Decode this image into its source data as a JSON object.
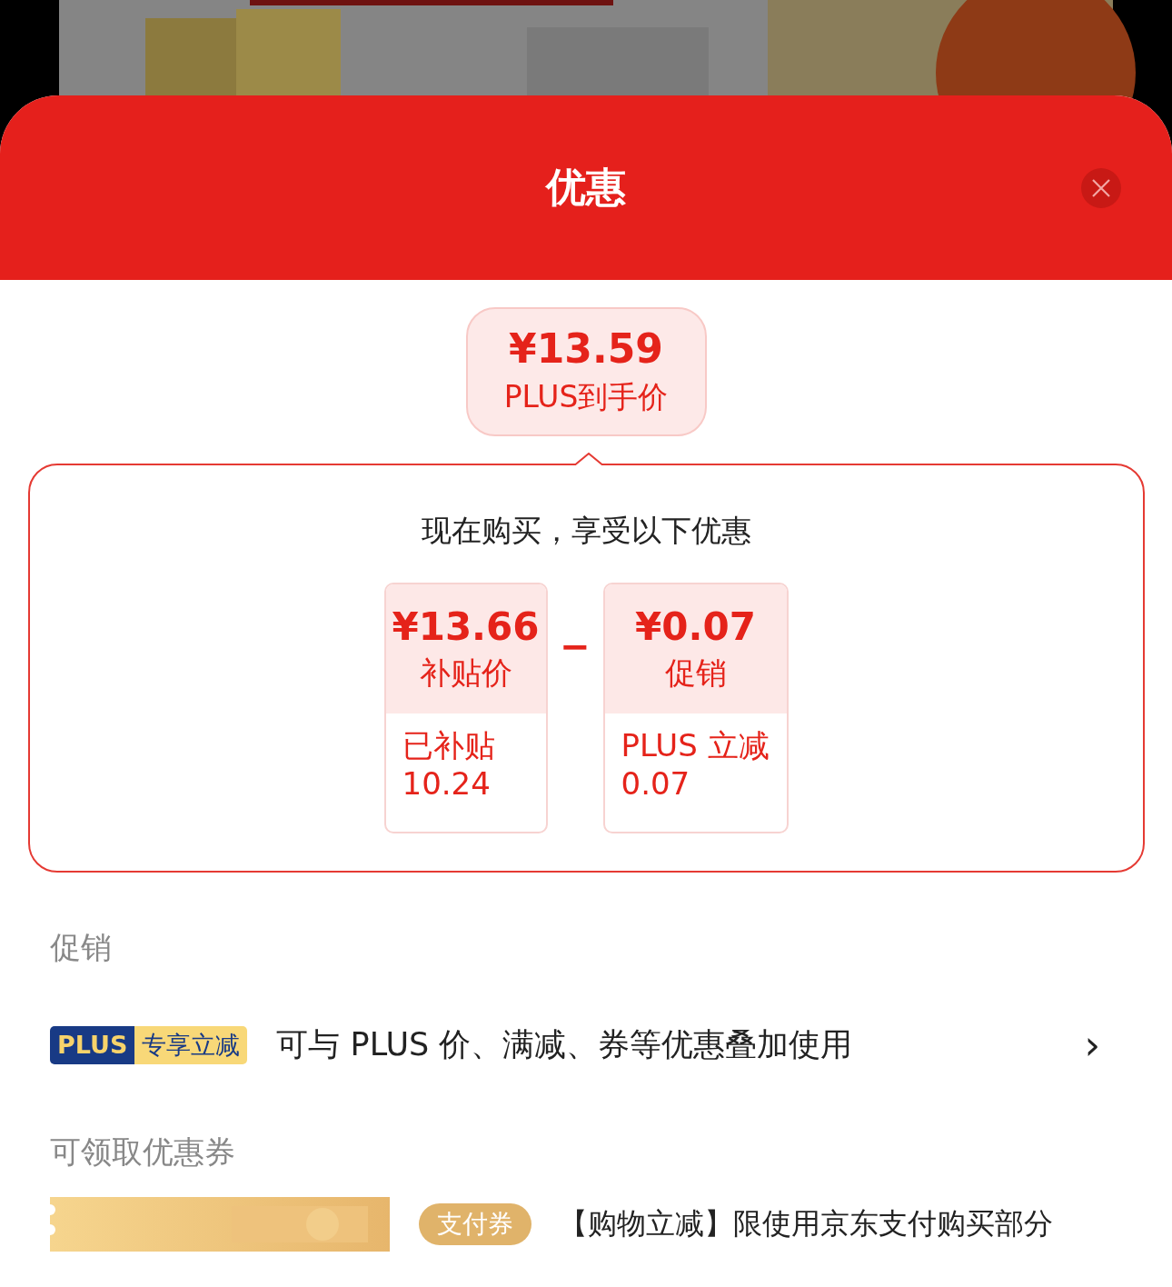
{
  "sheet": {
    "title": "优惠"
  },
  "final_price": {
    "amount": "¥13.59",
    "label": "PLUS到手价"
  },
  "breakdown": {
    "heading": "现在购买，享受以下优惠",
    "operator": "−",
    "cards": [
      {
        "amount": "¥13.66",
        "label": "补贴价",
        "detail": "已补贴\n10.24"
      },
      {
        "amount": "¥0.07",
        "label": "促销",
        "detail": "PLUS 立减\n0.07"
      }
    ]
  },
  "promotions": {
    "heading": "促销",
    "items": [
      {
        "tag_left": "PLUS",
        "tag_right": "专享立减",
        "text": "可与 PLUS 价、满减、券等优惠叠加使用",
        "arrow": "›"
      }
    ]
  },
  "coupons": {
    "heading": "可领取优惠券",
    "items": [
      {
        "badge": "支付券",
        "text": "【购物立减】限使用京东支付购买部分"
      }
    ]
  }
}
